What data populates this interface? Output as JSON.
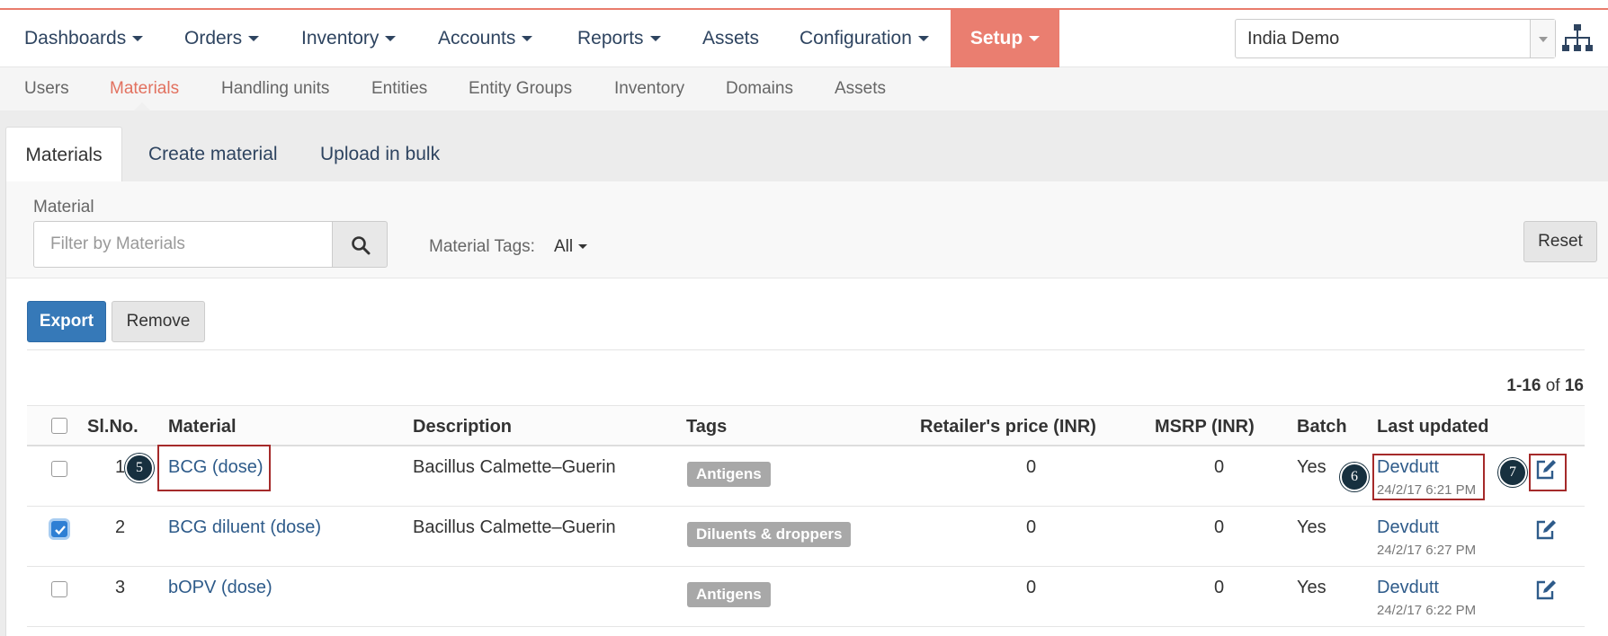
{
  "navbar": {
    "items": [
      {
        "label": "Dashboards",
        "caret": true
      },
      {
        "label": "Orders",
        "caret": true
      },
      {
        "label": "Inventory",
        "caret": true
      },
      {
        "label": "Accounts",
        "caret": true
      },
      {
        "label": "Reports",
        "caret": true
      },
      {
        "label": "Assets",
        "caret": false
      },
      {
        "label": "Configuration",
        "caret": true
      },
      {
        "label": "Setup",
        "caret": true,
        "active": true
      }
    ],
    "domain": "India Demo",
    "accent": "#ea7e70"
  },
  "subnav": {
    "items": [
      "Users",
      "Materials",
      "Handling units",
      "Entities",
      "Entity Groups",
      "Inventory",
      "Domains",
      "Assets"
    ],
    "active": "Materials"
  },
  "tabs": [
    "Materials",
    "Create material",
    "Upload in bulk"
  ],
  "filter": {
    "label": "Material",
    "placeholder": "Filter by Materials",
    "tags_label": "Material Tags:",
    "tags_value": "All",
    "reset": "Reset"
  },
  "actions": {
    "export": "Export",
    "remove": "Remove"
  },
  "pager": {
    "range": "1-16",
    "of": "of",
    "total": "16"
  },
  "table": {
    "headers": [
      "Sl.No.",
      "Material",
      "Description",
      "Tags",
      "Retailer's price (INR)",
      "MSRP (INR)",
      "Batch",
      "Last updated"
    ],
    "rows": [
      {
        "num": "1",
        "material": "BCG (dose)",
        "description": "Bacillus Calmette–Guerin",
        "tag": "Antigens",
        "price": "0",
        "msrp": "0",
        "batch": "Yes",
        "user": "Devdutt",
        "time": "24/2/17 6:21 PM",
        "checked": false
      },
      {
        "num": "2",
        "material": "BCG diluent (dose)",
        "description": "Bacillus Calmette–Guerin",
        "tag": "Diluents & droppers",
        "price": "0",
        "msrp": "0",
        "batch": "Yes",
        "user": "Devdutt",
        "time": "24/2/17 6:27 PM",
        "checked": true
      },
      {
        "num": "3",
        "material": "bOPV (dose)",
        "description": "",
        "tag": "Antigens",
        "price": "0",
        "msrp": "0",
        "batch": "Yes",
        "user": "Devdutt",
        "time": "24/2/17 6:22 PM",
        "checked": false
      }
    ]
  },
  "callouts": [
    "5",
    "6",
    "7"
  ]
}
